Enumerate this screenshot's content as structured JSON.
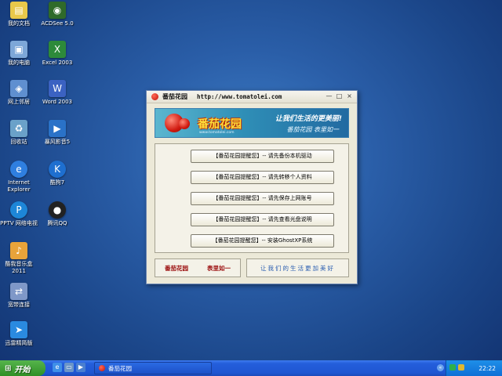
{
  "desktop": {
    "icons": [
      {
        "label": "我的文档",
        "icon": "my-documents-icon",
        "color": "#e8c84a",
        "glyph": "📁"
      },
      {
        "label": "ACDSee 5.0",
        "icon": "acdsee-icon",
        "color": "#2f6a2a",
        "glyph": "👁"
      },
      {
        "label": "我的电脑",
        "icon": "my-computer-icon",
        "color": "#7da7d8",
        "glyph": "🖥"
      },
      {
        "label": "Excel 2003",
        "icon": "excel-icon",
        "color": "#2d8a3a",
        "glyph": "X"
      },
      {
        "label": "网上邻居",
        "icon": "network-places-icon",
        "color": "#5f8fd0",
        "glyph": "🖧"
      },
      {
        "label": "Word 2003",
        "icon": "word-icon",
        "color": "#3b62c2",
        "glyph": "W"
      },
      {
        "label": "回收站",
        "icon": "recycle-bin-icon",
        "color": "#6aa1c9",
        "glyph": "🗑"
      },
      {
        "label": "暴风影音5",
        "icon": "baofeng-icon",
        "color": "#2a72c8",
        "glyph": "▶"
      },
      {
        "label": "Internet Explorer",
        "icon": "internet-explorer-icon",
        "color": "#2f7fe0",
        "glyph": "e"
      },
      {
        "label": "酷狗7",
        "icon": "kugou-icon",
        "color": "#1e6fd0",
        "glyph": "K"
      },
      {
        "label": "PPTV 网络电视",
        "icon": "pptv-icon",
        "color": "#1d86d8",
        "glyph": "P"
      },
      {
        "label": "腾讯QQ",
        "icon": "qq-icon",
        "color": "#222222",
        "glyph": "🐧"
      },
      {
        "label": "酷我音乐盒2011",
        "icon": "kuwo-icon",
        "color": "#e8a33a",
        "glyph": "♪"
      },
      {
        "label": "宽带连接",
        "icon": "broadband-icon",
        "color": "#7f98c8",
        "glyph": "🔌"
      },
      {
        "label": "迅雷精简版",
        "icon": "xunlei-icon",
        "color": "#2a8ae0",
        "glyph": "⚡"
      }
    ]
  },
  "window": {
    "title": "番茄花园",
    "url": "http://www.tomatolei.com",
    "btn_min": "—",
    "btn_max": "□",
    "btn_close": "×",
    "banner": {
      "logo": "番茄花园",
      "sub": "www.tomatolei.com",
      "slogan": "让我们生活的更美丽!",
      "slogan2": "番茄花园 表里如一"
    },
    "actions": [
      "【番茄花园提醒您】-- 请先备份本机驱动",
      "【番茄花园提醒您】-- 请先转移个人资料",
      "【番茄花园提醒您】-- 请先保存上网账号",
      "【番茄花园提醒您】-- 请先查看光盘说明",
      "【番茄花园提醒您】-- 安装GhostXP系统"
    ],
    "footer_left_1": "番茄花园",
    "footer_left_2": "表里如一",
    "footer_right": "让我们的生活更加美好"
  },
  "taskbar": {
    "start_label": "开始",
    "task_label": "番茄花园",
    "clock": "22:22"
  },
  "colors": {
    "desktop": "#2a5ea8",
    "taskbar": "#245edb",
    "start": "#3a9a2e",
    "footer_red": "#9a0b0b",
    "footer_blue": "#2a5db0"
  }
}
